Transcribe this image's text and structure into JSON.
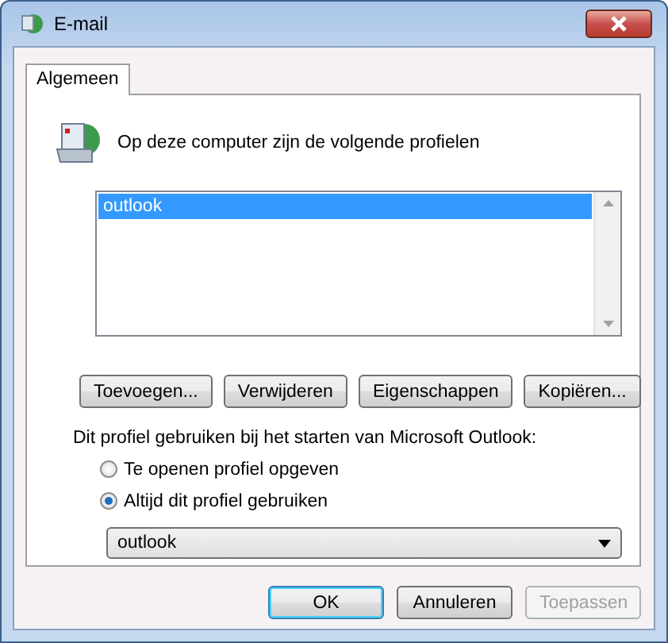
{
  "window": {
    "title": "E-mail"
  },
  "tabs": [
    {
      "label": "Algemeen",
      "selected": true
    }
  ],
  "intro": "Op deze computer zijn de volgende profielen",
  "profiles": [
    {
      "name": "outlook",
      "selected": true
    }
  ],
  "profile_buttons": [
    {
      "label": "Toevoegen..."
    },
    {
      "label": "Verwijderen"
    },
    {
      "label": "Eigenschappen"
    },
    {
      "label": "Kopiëren..."
    }
  ],
  "startup_label": "Dit profiel gebruiken bij het starten van Microsoft Outlook:",
  "startup_options": [
    {
      "label": "Te openen profiel opgeven",
      "selected": false
    },
    {
      "label": "Altijd dit profiel gebruiken",
      "selected": true
    }
  ],
  "profile_dropdown": {
    "value": "outlook"
  },
  "buttons": [
    {
      "label": "OK",
      "default": true,
      "disabled": false
    },
    {
      "label": "Annuleren",
      "default": false,
      "disabled": false
    },
    {
      "label": "Toepassen",
      "default": false,
      "disabled": true
    }
  ]
}
